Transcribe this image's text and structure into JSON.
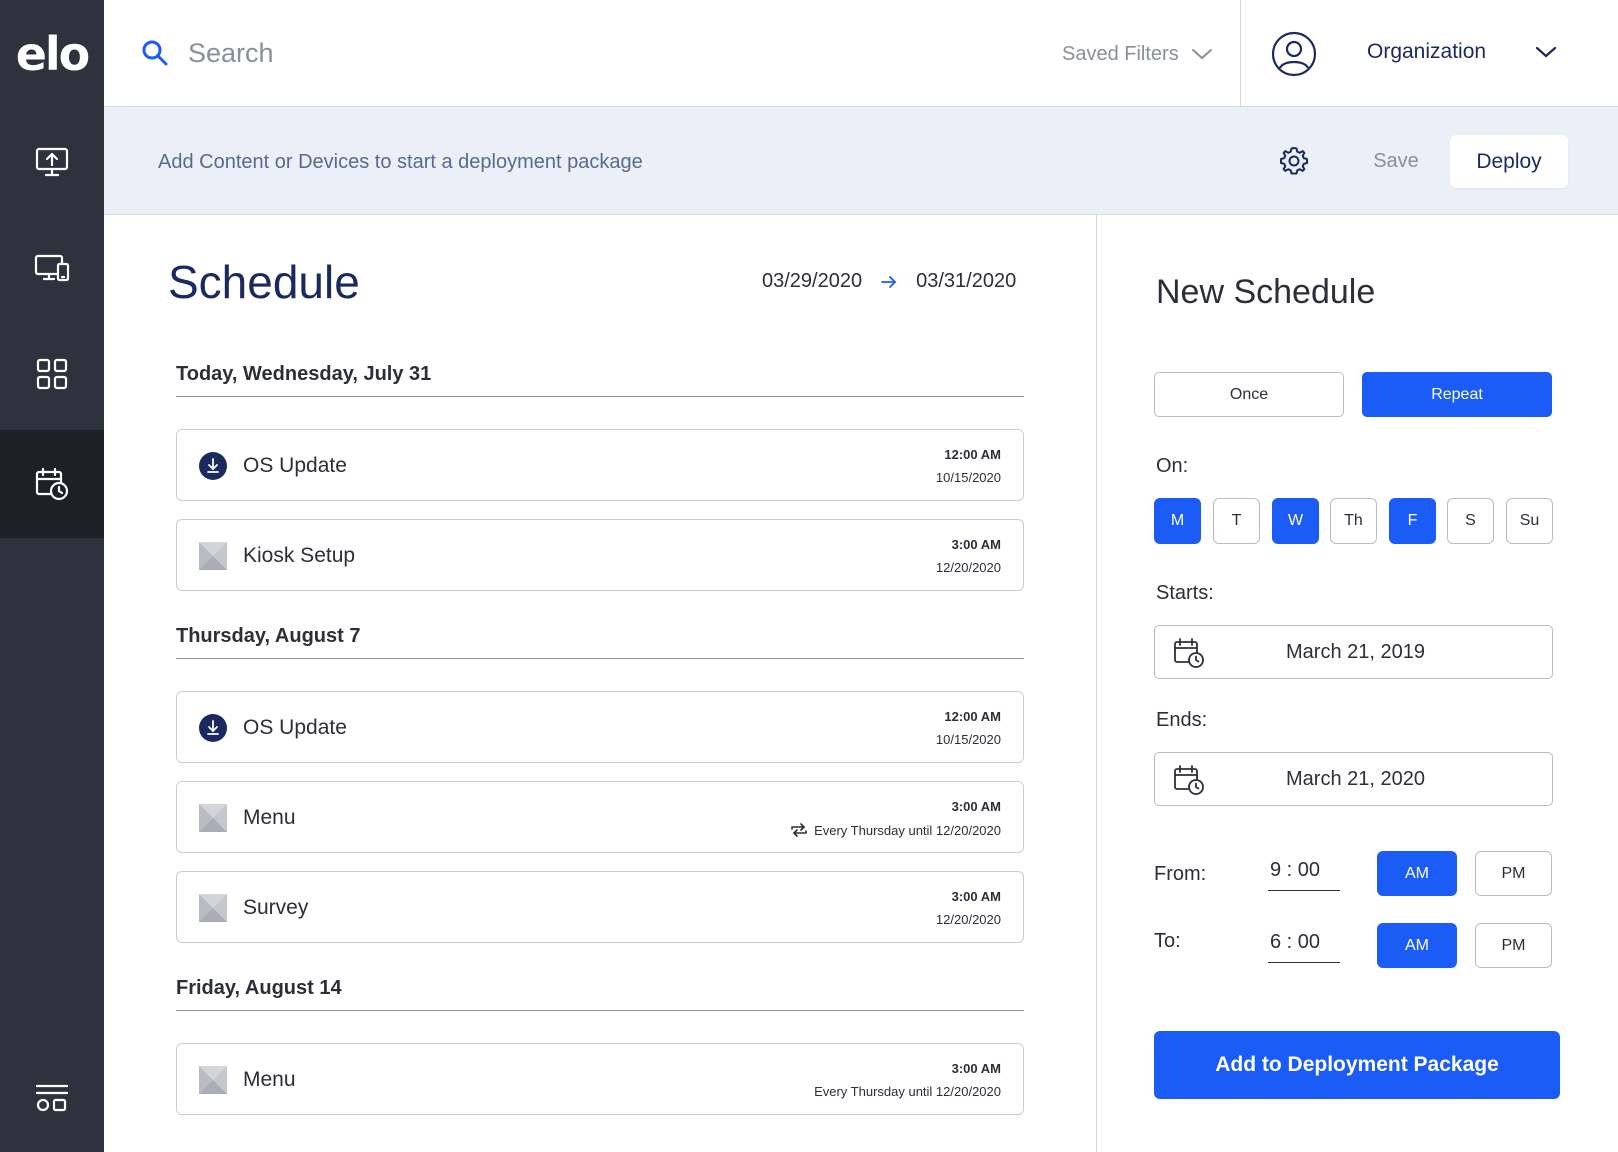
{
  "brand": {
    "logo": "elo",
    "accent": "#1a5cf5",
    "navy": "#1a2a5e",
    "sidebar_bg": "#2f323d"
  },
  "sidebar": {
    "items": [
      {
        "name": "upload-content",
        "icon": "monitor-upload-icon",
        "active": false
      },
      {
        "name": "devices",
        "icon": "devices-icon",
        "active": false
      },
      {
        "name": "apps",
        "icon": "grid-icon",
        "active": false
      },
      {
        "name": "schedule",
        "icon": "calendar-clock-icon",
        "active": true
      },
      {
        "name": "settings-panel",
        "icon": "panel-icon",
        "active": false
      }
    ]
  },
  "topbar": {
    "search_placeholder": "Search",
    "saved_filters": "Saved Filters",
    "organization": "Organization"
  },
  "deploybar": {
    "hint": "Add Content or Devices to start a deployment package",
    "save": "Save",
    "deploy": "Deploy"
  },
  "schedule": {
    "title": "Schedule",
    "range_start": "03/29/2020",
    "range_end": "03/31/2020",
    "days": [
      {
        "label": "Today, Wednesday, July 31",
        "items": [
          {
            "title": "OS Update",
            "icon": "download-icon",
            "time": "12:00 AM",
            "sub": "10/15/2020",
            "repeat": false
          },
          {
            "title": "Kiosk Setup",
            "icon": "image-placeholder-icon",
            "time": "3:00 AM",
            "sub": "12/20/2020",
            "repeat": false
          }
        ]
      },
      {
        "label": "Thursday, August 7",
        "items": [
          {
            "title": "OS Update",
            "icon": "download-icon",
            "time": "12:00 AM",
            "sub": "10/15/2020",
            "repeat": false
          },
          {
            "title": "Menu",
            "icon": "image-placeholder-icon",
            "time": "3:00 AM",
            "sub": "Every Thursday until 12/20/2020",
            "repeat": true
          },
          {
            "title": "Survey",
            "icon": "image-placeholder-icon",
            "time": "3:00 AM",
            "sub": "12/20/2020",
            "repeat": false
          }
        ]
      },
      {
        "label": "Friday, August 14",
        "items": [
          {
            "title": "Menu",
            "icon": "image-placeholder-icon",
            "time": "3:00 AM",
            "sub": "Every Thursday until 12/20/2020",
            "repeat": false
          }
        ]
      }
    ]
  },
  "panel": {
    "title": "New Schedule",
    "once": "Once",
    "repeat": "Repeat",
    "mode": "repeat",
    "on_label": "On:",
    "weekdays": [
      {
        "label": "M",
        "selected": true
      },
      {
        "label": "T",
        "selected": false
      },
      {
        "label": "W",
        "selected": true
      },
      {
        "label": "Th",
        "selected": false
      },
      {
        "label": "F",
        "selected": true
      },
      {
        "label": "S",
        "selected": false
      },
      {
        "label": "Su",
        "selected": false
      }
    ],
    "starts_label": "Starts:",
    "starts_value": "March 21, 2019",
    "ends_label": "Ends:",
    "ends_value": "March 21, 2020",
    "from_label": "From:",
    "from_value": "9 : 00",
    "from_period": "AM",
    "to_label": "To:",
    "to_value": "6 : 00",
    "to_period": "AM",
    "am": "AM",
    "pm": "PM",
    "add_button": "Add to Deployment Package"
  }
}
